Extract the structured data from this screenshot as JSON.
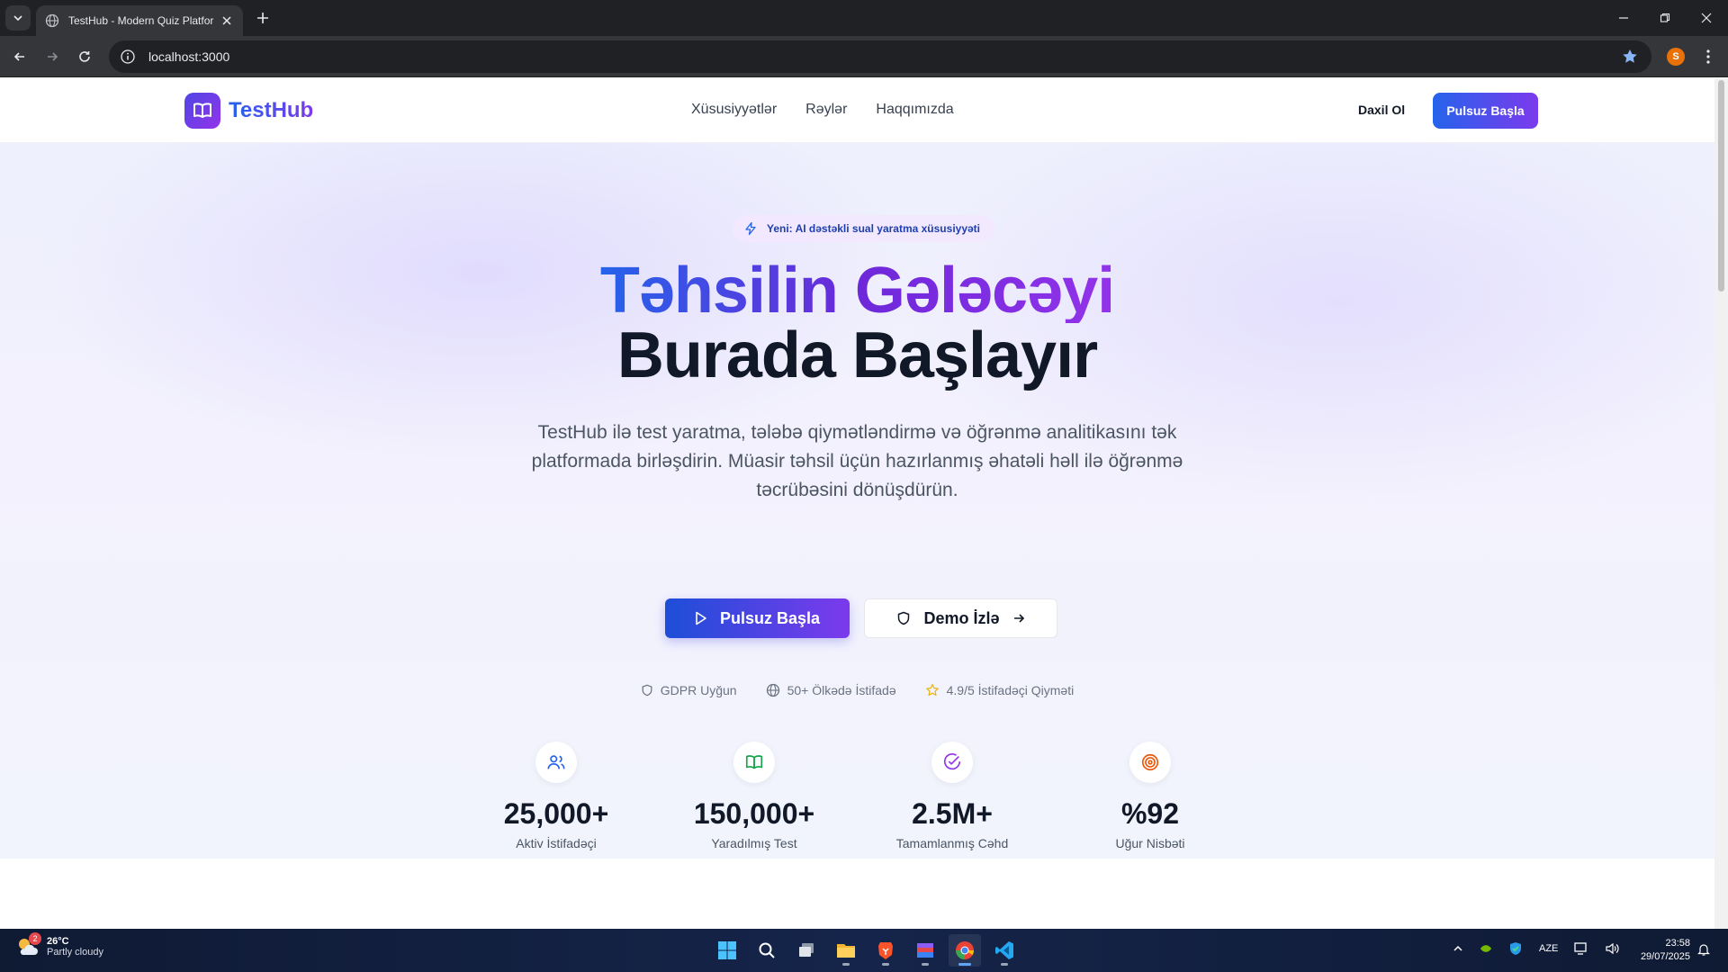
{
  "browser": {
    "tab_title": "TestHub - Modern Quiz Platform",
    "url": "localhost:3000",
    "profile_initial": "S"
  },
  "header": {
    "brand": "TestHub",
    "nav": [
      "Xüsusiyyətlər",
      "Rəylər",
      "Haqqımızda"
    ],
    "login": "Daxil Ol",
    "cta": "Pulsuz Başla"
  },
  "hero": {
    "badge": "Yeni: AI dəstəkli sual yaratma xüsusiyyəti",
    "headline_line1": "Təhsilin Gələcəyi",
    "headline_line2": "Burada Başlayır",
    "subtitle": "TestHub ilə test yaratma, tələbə qiymətləndirmə və öğrənmə analitikasını tək platformada birləşdirin. Müasir təhsil üçün hazırlanmış əhatəli həll ilə öğrənmə təcrübəsini dönüşdürün.",
    "primary_button": "Pulsuz Başla",
    "secondary_button": "Demo İzlə",
    "trust": [
      {
        "icon": "shield-icon",
        "label": "GDPR Uyğun"
      },
      {
        "icon": "globe-icon",
        "label": "50+ Ölkədə İstifadə"
      },
      {
        "icon": "star-icon",
        "label": "4.9/5 İstifadəçi Qiyməti"
      }
    ]
  },
  "stats": [
    {
      "icon": "users-icon",
      "color": "#2563eb",
      "value": "25,000+",
      "label": "Aktiv İstifadəçi"
    },
    {
      "icon": "book-icon",
      "color": "#16a34a",
      "value": "150,000+",
      "label": "Yaradılmış Test"
    },
    {
      "icon": "check-circle-icon",
      "color": "#9333ea",
      "value": "2.5M+",
      "label": "Tamamlanmış Cəhd"
    },
    {
      "icon": "target-icon",
      "color": "#ea580c",
      "value": "%92",
      "label": "Uğur Nisbəti"
    }
  ],
  "taskbar": {
    "weather_temp": "26°C",
    "weather_desc": "Partly cloudy",
    "weather_badge": "2",
    "language": "AZE",
    "time": "23:58",
    "date": "29/07/2025"
  },
  "colors": {
    "brand_blue": "#2563eb",
    "brand_purple": "#7c3aed"
  }
}
